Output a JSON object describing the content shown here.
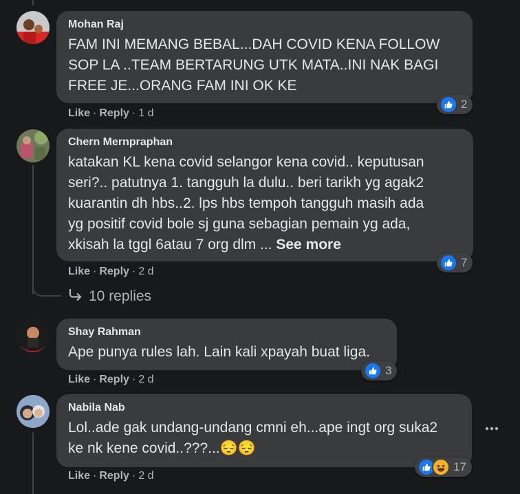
{
  "actions": {
    "like": "Like",
    "reply": "Reply",
    "dot": "·"
  },
  "comments": [
    {
      "author": "Mohan Raj",
      "text": "FAM INI MEMANG BEBAL...DAH COVID KENA FOLLOW\nSOP LA ..TEAM BERTARUNG UTK MATA..INI NAK BAGI\nFREE JE...ORANG FAM INI OK KE",
      "time": "1 d",
      "reaction_count": "2"
    },
    {
      "author": "Chern Mernpraphan",
      "text": "katakan KL kena covid selangor kena covid.. keputusan\nseri?.. patutnya 1. tangguh la dulu.. beri tarikh yg agak2\nkuarantin dh hbs..2. lps hbs tempoh tangguh masih ada\nyg positif covid bole sj guna sebagian pemain yg ada,\nxkisah la tggl 6atau 7 org dlm ... ",
      "see_more": "See more",
      "time": "2 d",
      "reaction_count": "7",
      "replies_label": "10 replies"
    },
    {
      "author": "Shay Rahman",
      "text": "Ape punya rules lah. Lain kali xpayah buat liga.",
      "time": "2 d",
      "reaction_count": "3"
    },
    {
      "author": "Nabila Nab",
      "text": "Lol..ade gak undang-undang cmni eh...ape ingt org suka2\nke nk kene covid..???...",
      "emojis": "😔😔",
      "time": "2 d",
      "reaction_count": "17"
    }
  ],
  "colors": {
    "background": "#18191a",
    "bubble": "#3a3b3c",
    "like_blue": "#1877f2",
    "haha_yellow": "#f7b125"
  },
  "icons": [
    "like-icon",
    "haha-icon",
    "reply-arrow-icon",
    "more-options-icon"
  ]
}
